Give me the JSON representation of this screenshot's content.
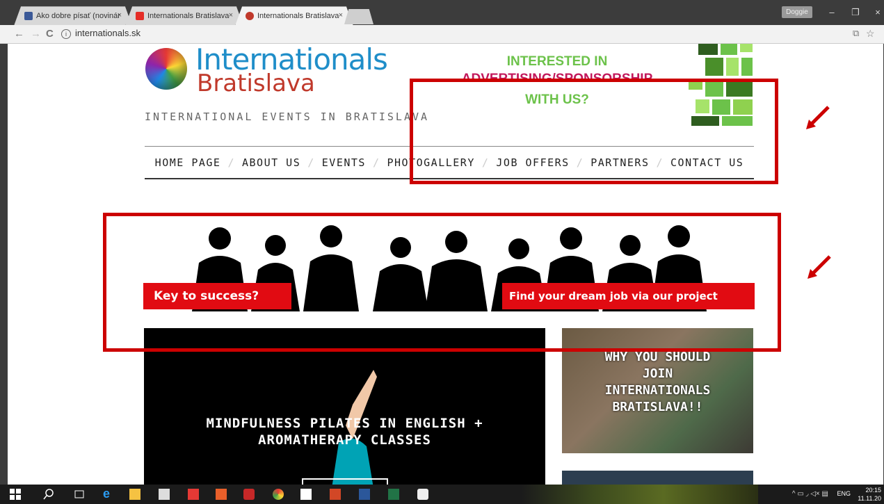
{
  "browser": {
    "tabs": [
      {
        "label": "Ako dobre písať (novinár",
        "icon": "facebook-icon",
        "color": "#3b5998",
        "active": false
      },
      {
        "label": "Internationals Bratislava",
        "icon": "youtube-icon",
        "color": "#e52d27",
        "active": false
      },
      {
        "label": "Internationals Bratislava |",
        "icon": "globe-icon",
        "color": "#c0392b",
        "active": true
      }
    ],
    "close_glyph": "×",
    "user_chip": "Doggie",
    "window_buttons": {
      "minimize": "–",
      "restore": "❐",
      "close": "×"
    },
    "url": "internationals.sk",
    "nav_glyphs": {
      "back": "←",
      "forward": "→",
      "reload": "C"
    },
    "toolbar_icons": {
      "translate": "⧉",
      "bookmark": "☆"
    }
  },
  "site": {
    "brand_line1": "Internationals",
    "brand_line2": "Bratislava",
    "tagline": "INTERNATIONAL EVENTS IN BRATISLAVA",
    "ad": {
      "line1": "INTERESTED IN",
      "line2": "ADVERTISING/SPONSORSHIP",
      "line3": "WITH US?"
    },
    "nav": [
      "HOME PAGE",
      "ABOUT US",
      "EVENTS",
      "PHOTOGALLERY",
      "JOB OFFERS",
      "PARTNERS",
      "CONTACT US"
    ],
    "job_banner": {
      "left_label": "Key to success?",
      "right_label": "Find your dream job via our project"
    },
    "feature_title_line1": "MINDFULNESS PILATES IN ENGLISH +",
    "feature_title_line2": "AROMATHERAPY CLASSES",
    "side_card": [
      "WHY YOU SHOULD",
      "JOIN",
      "INTERNATIONALS",
      "BRATISLAVA!!"
    ]
  },
  "taskbar": {
    "language": "ENG",
    "time": "20:15",
    "date": "11.11.20",
    "tray": "^ ▭ ◞ ◁× ▤"
  },
  "colors": {
    "annotation": "#cc0000",
    "brand_blue": "#1f8ec9",
    "brand_red": "#c0392b",
    "banner_red": "#e10b12"
  }
}
